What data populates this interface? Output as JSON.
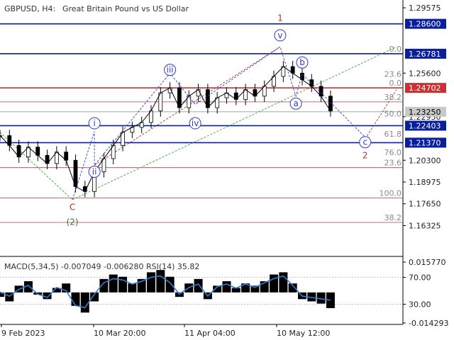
{
  "header": {
    "symbol": "GBPUSD, H4:",
    "description": "Great Britain Pound vs US Dollar"
  },
  "indicator": {
    "label": "MACD(5,34,5) -0.007049 -0.006280 RSI(14) 35.82"
  },
  "colors": {
    "main_level": "#0a1f9b",
    "red_level": "#c83232",
    "fib_line": "#b04040",
    "wave_blue": "#2e3cc8",
    "wave_red": "#b03030",
    "wave_green": "#2e7d32",
    "forecast_green": "#3aa33a",
    "candle": "#000000",
    "price_tag_bg": "#0a1f9b",
    "red_tag_bg": "#c83232",
    "rsi_line": "#2f7fd6"
  },
  "chart_data": {
    "type": "line",
    "title": "GBPUSD, H4: Great Britain Pound vs US Dollar",
    "price_axis": {
      "ylim": [
        1.1445,
        1.3005
      ],
      "ticks": [
        "1.29575",
        "1.25600",
        "1.22950",
        "1.20300",
        "1.18975",
        "1.17650",
        "1.16325"
      ],
      "tick_values": [
        1.29575,
        1.256,
        1.2295,
        1.203,
        1.18975,
        1.1765,
        1.16325
      ]
    },
    "x_ticks": [
      "9 Feb 2023",
      "10 Mar 20:00",
      "11 Apr 04:00",
      "10 May 12:00"
    ],
    "key_levels": [
      {
        "value": 1.286,
        "label": "1.28600",
        "style": "blue-tag"
      },
      {
        "value": 1.26781,
        "label": "1.26781",
        "style": "blue-tag"
      },
      {
        "value": 1.24702,
        "label": "1.24702",
        "style": "red-tag"
      },
      {
        "value": 1.2325,
        "label": "1.23250",
        "style": "current-price"
      },
      {
        "value": 1.22403,
        "label": "1.22403",
        "style": "blue-tag"
      },
      {
        "value": 1.2137,
        "label": "1.21370",
        "style": "blue-tag"
      }
    ],
    "fib_labels": [
      {
        "text": "0.0",
        "value": 1.26781
      },
      {
        "text": "23.6",
        "value": 1.2525
      },
      {
        "text": "0.0",
        "value": 1.247
      },
      {
        "text": "38.2",
        "value": 1.2385
      },
      {
        "text": "50.0",
        "value": 1.2283
      },
      {
        "text": "61.8",
        "value": 1.216
      },
      {
        "text": "76.0",
        "value": 1.2048
      },
      {
        "text": "23.6",
        "value": 1.1985
      },
      {
        "text": "100.0",
        "value": 1.18
      },
      {
        "text": "38.2",
        "value": 1.1652
      }
    ],
    "fib_lines": [
      1.2385,
      1.1985,
      1.18,
      1.1652
    ],
    "wave_labels": [
      {
        "text": "1",
        "shape": "plain",
        "color": "wave_red",
        "x": "2023-05-02",
        "y": 1.2895
      },
      {
        "text": "v",
        "shape": "circle",
        "color": "wave_blue",
        "x": "2023-05-02",
        "y": 1.279
      },
      {
        "text": "iii",
        "shape": "circle",
        "color": "wave_blue",
        "x": "2023-03-28",
        "y": 1.258
      },
      {
        "text": "i",
        "shape": "circle",
        "color": "wave_blue",
        "x": "2023-03-04",
        "y": 1.2255
      },
      {
        "text": "ii",
        "shape": "circle",
        "color": "wave_blue",
        "x": "2023-03-04",
        "y": 1.196
      },
      {
        "text": "iv",
        "shape": "circle",
        "color": "wave_blue",
        "x": "2023-04-05",
        "y": 1.2255
      },
      {
        "text": "b",
        "shape": "circle",
        "color": "wave_blue",
        "x": "2023-05-09",
        "y": 1.2625
      },
      {
        "text": "a",
        "shape": "circle",
        "color": "wave_blue",
        "x": "2023-05-07",
        "y": 1.2375
      },
      {
        "text": "c",
        "shape": "circle",
        "color": "wave_blue",
        "x": "2023-05-29",
        "y": 1.214
      },
      {
        "text": "2",
        "shape": "plain",
        "color": "wave_red",
        "x": "2023-05-29",
        "y": 1.206
      },
      {
        "text": "C",
        "shape": "plain",
        "color": "wave_red",
        "x": "2023-02-25",
        "y": 1.1745
      },
      {
        "text": "(2)",
        "shape": "plain",
        "color": "wave_green",
        "x": "2023-02-25",
        "y": 1.1655
      }
    ],
    "price_series": {
      "name": "GBPUSD H4 close",
      "x": [
        "2023-02-02",
        "2023-02-05",
        "2023-02-08",
        "2023-02-11",
        "2023-02-14",
        "2023-02-17",
        "2023-02-20",
        "2023-02-23",
        "2023-02-26",
        "2023-03-01",
        "2023-03-04",
        "2023-03-07",
        "2023-03-10",
        "2023-03-13",
        "2023-03-16",
        "2023-03-19",
        "2023-03-22",
        "2023-03-25",
        "2023-03-28",
        "2023-03-31",
        "2023-04-03",
        "2023-04-06",
        "2023-04-09",
        "2023-04-12",
        "2023-04-15",
        "2023-04-18",
        "2023-04-21",
        "2023-04-24",
        "2023-04-27",
        "2023-04-30",
        "2023-05-03",
        "2023-05-06",
        "2023-05-09",
        "2023-05-12",
        "2023-05-15",
        "2023-05-18"
      ],
      "values": [
        1.218,
        1.212,
        1.205,
        1.211,
        1.206,
        1.201,
        1.208,
        1.203,
        1.187,
        1.184,
        1.196,
        1.204,
        1.212,
        1.22,
        1.223,
        1.226,
        1.233,
        1.244,
        1.247,
        1.235,
        1.242,
        1.246,
        1.235,
        1.241,
        1.244,
        1.24,
        1.246,
        1.242,
        1.248,
        1.254,
        1.26,
        1.256,
        1.252,
        1.248,
        1.242,
        1.233
      ]
    },
    "wave_path": {
      "x": [
        "2023-02-25",
        "2023-03-04",
        "2023-03-04",
        "2023-03-28",
        "2023-04-05",
        "2023-05-02",
        "2023-05-07",
        "2023-05-09",
        "2023-05-29"
      ],
      "y": [
        1.179,
        1.2205,
        1.2,
        1.256,
        1.237,
        1.272,
        1.242,
        1.2555,
        1.217
      ]
    },
    "forecast_lines": [
      {
        "x": [
          "2023-02-25",
          "2023-06-08"
        ],
        "y": [
          1.179,
          1.272
        ],
        "color": "forecast_green"
      },
      {
        "x": [
          "2023-02-02",
          "2023-02-25"
        ],
        "y": [
          1.22,
          1.179
        ],
        "color": "forecast_green"
      },
      {
        "x": [
          "2023-03-04",
          "2023-05-02"
        ],
        "y": [
          1.2,
          1.272
        ],
        "color": "wave_red"
      },
      {
        "x": [
          "2023-05-29",
          "2023-06-08"
        ],
        "y": [
          1.216,
          1.246
        ],
        "color": "wave_red"
      }
    ],
    "indicator_panel": {
      "ylim": [
        -0.014293,
        0.01577
      ],
      "ticks": [
        "0.015770",
        "70.00",
        "30.00",
        "-0.014293"
      ],
      "macd_histogram": [
        -0.002,
        -0.004,
        0.003,
        0.005,
        -0.001,
        -0.003,
        0.002,
        0.004,
        -0.006,
        -0.009,
        -0.004,
        0.006,
        0.008,
        0.007,
        0.004,
        0.006,
        0.009,
        0.01,
        0.007,
        -0.002,
        0.004,
        0.006,
        -0.003,
        0.003,
        0.005,
        0.002,
        0.004,
        0.003,
        0.005,
        0.008,
        0.009,
        0.004,
        -0.003,
        -0.004,
        -0.005,
        -0.007
      ],
      "rsi": [
        48,
        42,
        52,
        58,
        45,
        40,
        55,
        50,
        28,
        25,
        45,
        62,
        68,
        66,
        60,
        64,
        70,
        72,
        62,
        45,
        55,
        60,
        42,
        56,
        60,
        54,
        60,
        55,
        62,
        68,
        72,
        58,
        42,
        40,
        38,
        36
      ]
    }
  }
}
